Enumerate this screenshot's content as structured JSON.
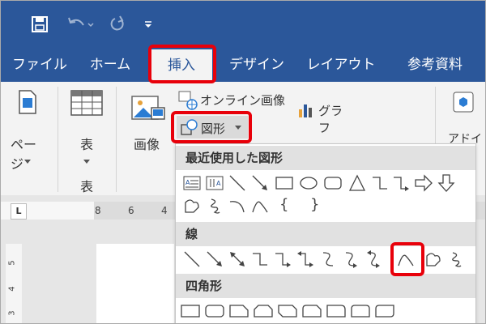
{
  "quick_access": {
    "save": "save-icon",
    "undo": "undo-icon",
    "redo": "redo-icon",
    "customize": "customize-icon"
  },
  "tabs": [
    "ファイル",
    "ホーム",
    "挿入",
    "デザイン",
    "レイアウト",
    "参考資料"
  ],
  "active_tab": "挿入",
  "ribbon": {
    "page_label": "ページ",
    "table_label": "表",
    "table_group": "表",
    "picture_label": "画像",
    "online_picture_label": "オンライン画像",
    "shapes_label": "図形",
    "chart_label": "グラフ",
    "addin_label": "アドイ"
  },
  "ruler": {
    "numbers": [
      "8",
      "6",
      "4"
    ],
    "tab_stop": "L"
  },
  "vruler": {
    "numbers": [
      "5",
      "4",
      "3"
    ]
  },
  "dropdown": {
    "sections": [
      "最近使用した図形",
      "線",
      "四角形"
    ],
    "recent_text": [
      "{",
      "}"
    ],
    "lines_count": 12,
    "rect_count": 9
  },
  "colors": {
    "brand": "#2b579a",
    "highlight": "#e8000a"
  }
}
